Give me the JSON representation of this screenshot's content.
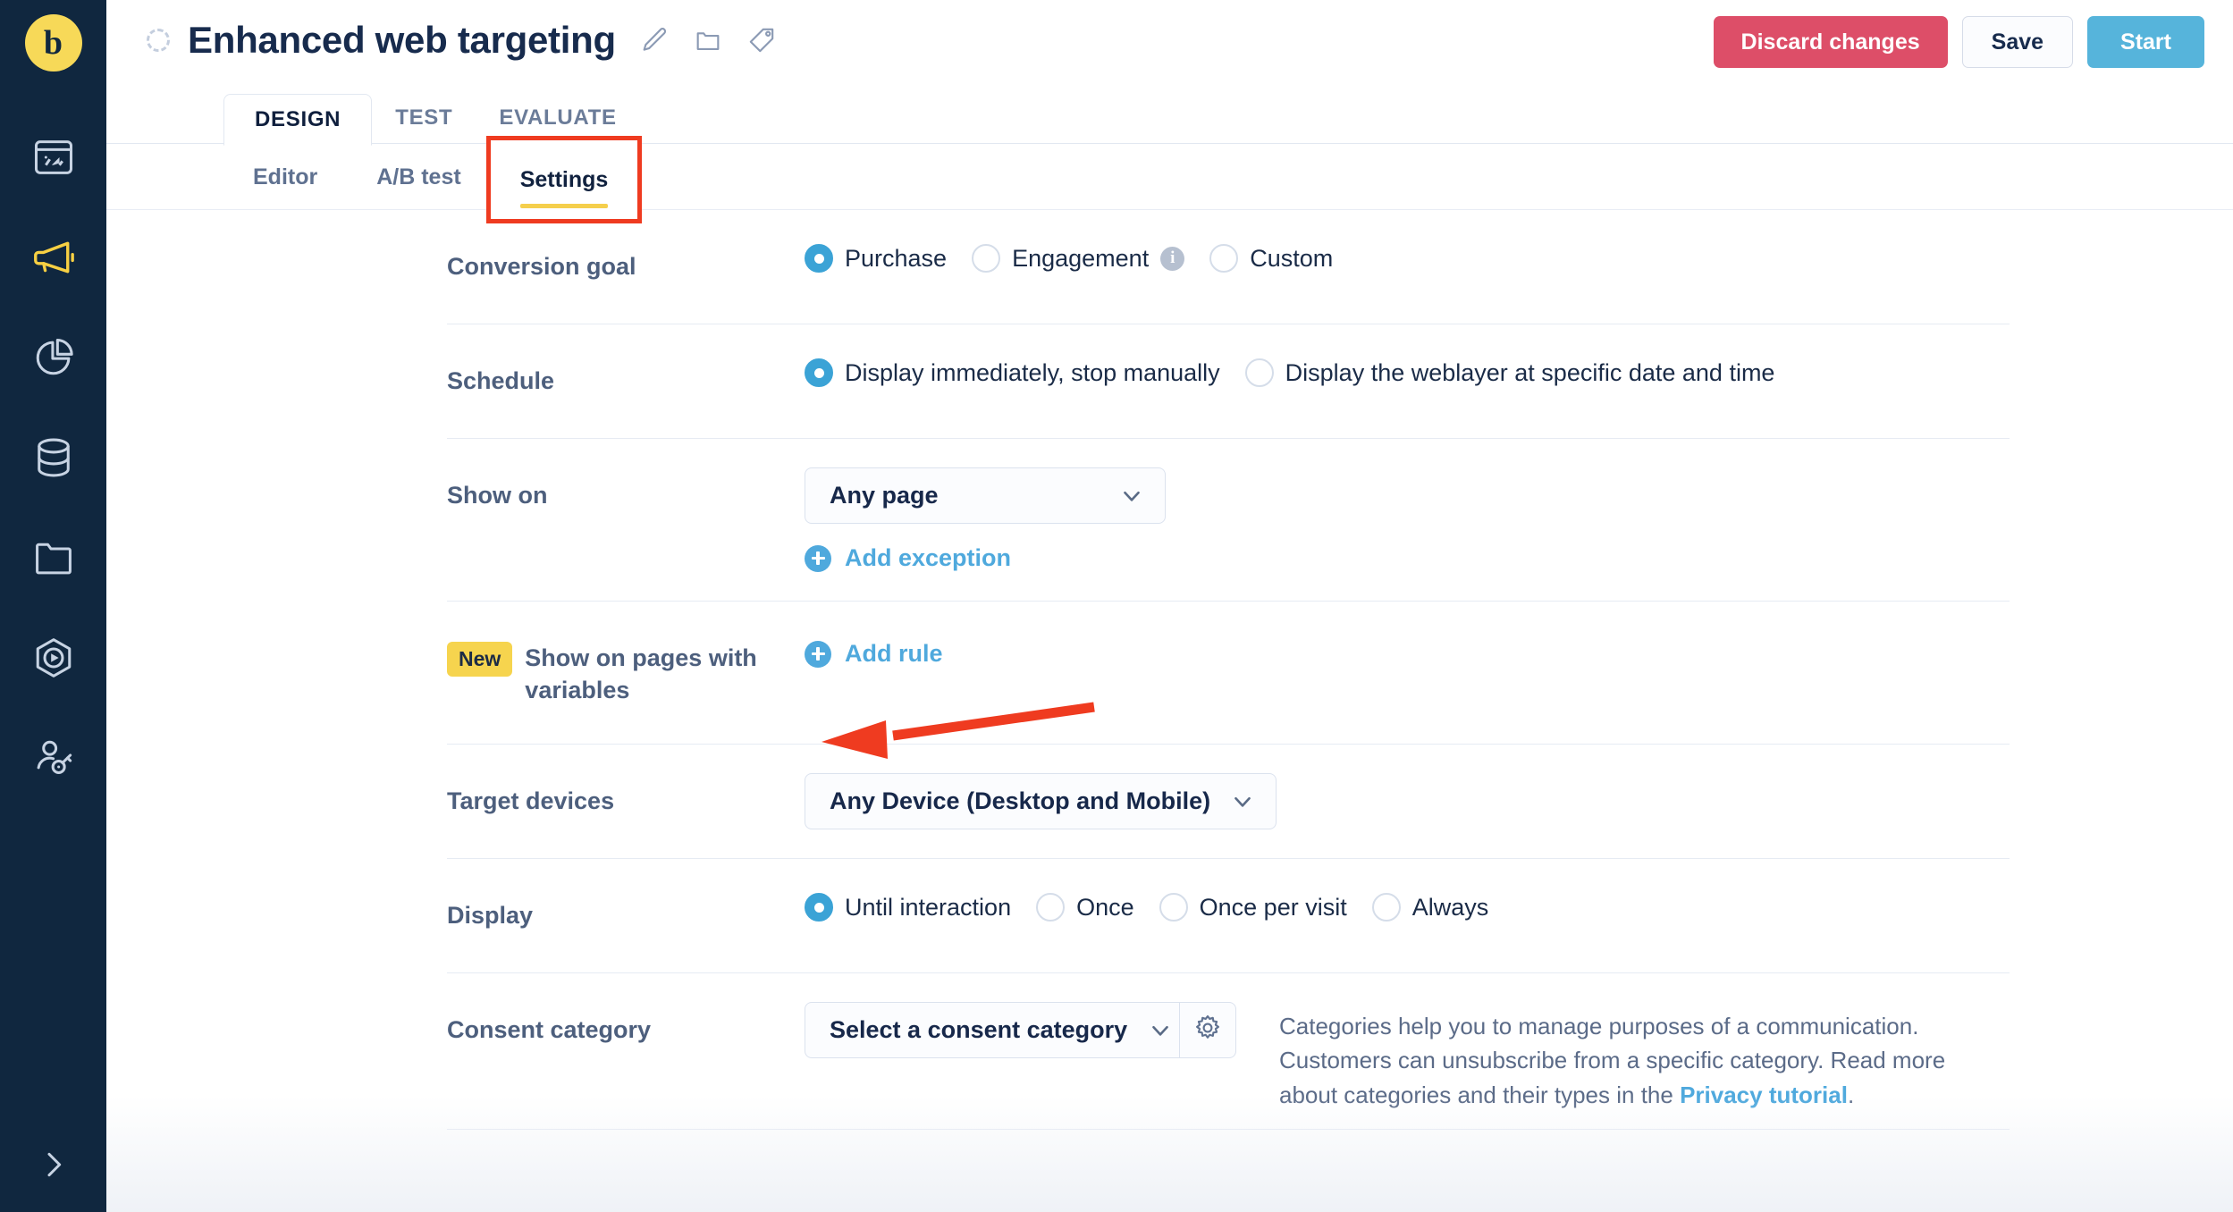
{
  "colors": {
    "rail_bg": "#10273f",
    "accent_yellow": "#f7d958",
    "accent_blue": "#4fa9dd",
    "danger_red": "#dd4e68",
    "annotation_red": "#ef3b20",
    "text_dark": "#172b4d",
    "text_muted": "#5b6b88"
  },
  "rail": {
    "logo_glyph": "b",
    "items": [
      {
        "icon": "dashboard-icon",
        "label": "Dashboard",
        "active": false
      },
      {
        "icon": "megaphone-icon",
        "label": "Campaigns",
        "active": true
      },
      {
        "icon": "pie-chart-icon",
        "label": "Analytics",
        "active": false
      },
      {
        "icon": "database-icon",
        "label": "Data",
        "active": false
      },
      {
        "icon": "folder-icon",
        "label": "Library",
        "active": false
      },
      {
        "icon": "play-hexagon-icon",
        "label": "Automation",
        "active": false
      },
      {
        "icon": "user-key-icon",
        "label": "Audience",
        "active": false
      }
    ],
    "expand_icon": "chevron-right-icon"
  },
  "header": {
    "status_icon": "status-circle-icon",
    "title": "Enhanced web targeting",
    "icons": [
      {
        "name": "edit-pencil-icon"
      },
      {
        "name": "folder-icon"
      },
      {
        "name": "tag-icon"
      }
    ],
    "actions": {
      "discard": "Discard changes",
      "save": "Save",
      "start": "Start"
    }
  },
  "tabs_main": [
    {
      "label": "DESIGN",
      "active": true
    },
    {
      "label": "TEST",
      "active": false
    },
    {
      "label": "EVALUATE",
      "active": false
    }
  ],
  "tabs_sub": [
    {
      "label": "Editor",
      "active": false,
      "highlighted": false
    },
    {
      "label": "A/B test",
      "active": false,
      "highlighted": false
    },
    {
      "label": "Settings",
      "active": true,
      "highlighted": true
    }
  ],
  "form": {
    "conversion_goal": {
      "label": "Conversion goal",
      "options": [
        {
          "label": "Purchase",
          "checked": true,
          "info": false
        },
        {
          "label": "Engagement",
          "checked": false,
          "info": true
        },
        {
          "label": "Custom",
          "checked": false,
          "info": false
        }
      ]
    },
    "schedule": {
      "label": "Schedule",
      "options": [
        {
          "label": "Display immediately, stop manually",
          "checked": true
        },
        {
          "label": "Display the weblayer at specific date and time",
          "checked": false
        }
      ]
    },
    "show_on": {
      "label": "Show on",
      "select_value": "Any page",
      "add_link": "Add exception"
    },
    "variables": {
      "badge": "New",
      "label": "Show on pages with variables",
      "add_link": "Add rule"
    },
    "target_devices": {
      "label": "Target devices",
      "select_value": "Any Device (Desktop and Mobile)"
    },
    "display": {
      "label": "Display",
      "options": [
        {
          "label": "Until interaction",
          "checked": true
        },
        {
          "label": "Once",
          "checked": false
        },
        {
          "label": "Once per visit",
          "checked": false
        },
        {
          "label": "Always",
          "checked": false
        }
      ]
    },
    "consent": {
      "label": "Consent category",
      "select_value": "Select a consent category",
      "gear_icon": "gear-icon",
      "description_before": "Categories help you to manage purposes of a communication. Customers can unsubscribe from a specific category. Read more about categories and their types in the ",
      "description_link": "Privacy tutorial",
      "description_after": "."
    }
  },
  "annotations": {
    "highlight_target": "Settings",
    "arrow_target": "Add rule"
  }
}
